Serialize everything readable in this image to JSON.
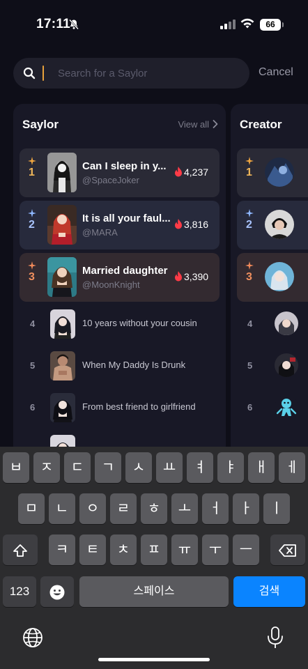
{
  "status_bar": {
    "time": "17:11",
    "battery": "66"
  },
  "search": {
    "placeholder": "Search for a Saylor",
    "cancel_label": "Cancel"
  },
  "saylor_panel": {
    "title": "Saylor",
    "view_all": "View all",
    "top": [
      {
        "rank": "1",
        "title": "Can I sleep in y...",
        "author": "@SpaceJoker",
        "count": "4,237",
        "sparkle_color": "#f0a640",
        "rank_color": "#f0b75a"
      },
      {
        "rank": "2",
        "title": "It is all your faul...",
        "author": "@MARA",
        "count": "3,816",
        "sparkle_color": "#8fb8ff",
        "rank_color": "#a9c4ff"
      },
      {
        "rank": "3",
        "title": "Married daughter",
        "author": "@MoonKnight",
        "count": "3,390",
        "sparkle_color": "#f08a5a",
        "rank_color": "#f08f5e"
      }
    ],
    "rest": [
      {
        "rank": "4",
        "title": "10 years without your cousin"
      },
      {
        "rank": "5",
        "title": "When My Daddy Is Drunk"
      },
      {
        "rank": "6",
        "title": "From best friend to girlfriend"
      }
    ]
  },
  "creator_panel": {
    "title": "Creator",
    "top": [
      {
        "rank": "1"
      },
      {
        "rank": "2"
      },
      {
        "rank": "3"
      }
    ],
    "rest": [
      {
        "rank": "4"
      },
      {
        "rank": "5"
      },
      {
        "rank": "6"
      }
    ]
  },
  "keyboard": {
    "row1": [
      "ㅂ",
      "ㅈ",
      "ㄷ",
      "ㄱ",
      "ㅅ",
      "ㅛ",
      "ㅕ",
      "ㅑ",
      "ㅐ",
      "ㅔ"
    ],
    "row2": [
      "ㅁ",
      "ㄴ",
      "ㅇ",
      "ㄹ",
      "ㅎ",
      "ㅗ",
      "ㅓ",
      "ㅏ",
      "ㅣ"
    ],
    "row3": [
      "ㅋ",
      "ㅌ",
      "ㅊ",
      "ㅍ",
      "ㅠ",
      "ㅜ",
      "ㅡ"
    ],
    "numbers_label": "123",
    "space_label": "스페이스",
    "search_label": "검색"
  }
}
